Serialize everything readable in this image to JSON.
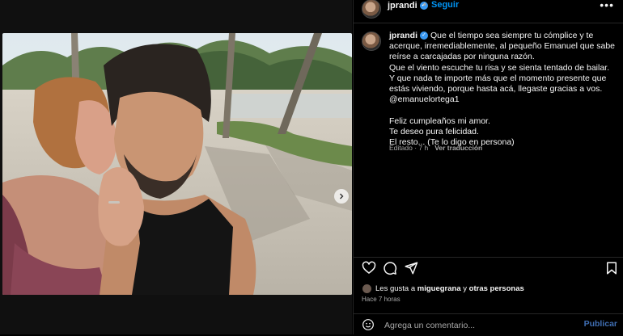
{
  "post": {
    "username": "jprandi",
    "follow_label": "Seguir",
    "separator": "•",
    "more_label": "•••"
  },
  "caption": {
    "username": "jprandi",
    "text": "Que el tiempo sea siempre tu cómplice y te acerque, irremediablemente, al pequeño Emanuel que sabe reírse a carcajadas por ninguna razón.\nQue el viento escuche tu risa y se sienta tentado de bailar.\nY que nada te importe más que el momento presente que estás viviendo, porque hasta acá, llegaste gracias a vos.\n@emanuelortega1\n\nFeliz cumpleaños mi amor.\nTe deseo pura felicidad.\nEl resto... (Te lo digo en persona)",
    "edited": "Editado · 7 h",
    "translate": "Ver traducción"
  },
  "likes": {
    "prefix": "Les gusta a",
    "user": "miguegrana",
    "connector": "y",
    "others": "otras personas"
  },
  "time_ago": "Hace 7 horas",
  "comment": {
    "placeholder": "Agrega un comentario...",
    "publish": "Publicar"
  },
  "carousel": {
    "total": 2,
    "current": 1
  },
  "icons": [
    "heart-icon",
    "comment-icon",
    "share-icon",
    "bookmark-icon",
    "emoji-icon",
    "chevron-right-icon",
    "verified-icon"
  ],
  "colors": {
    "accent": "#0095f6",
    "publish": "#3f6eb3",
    "verified": "#3897f0"
  }
}
